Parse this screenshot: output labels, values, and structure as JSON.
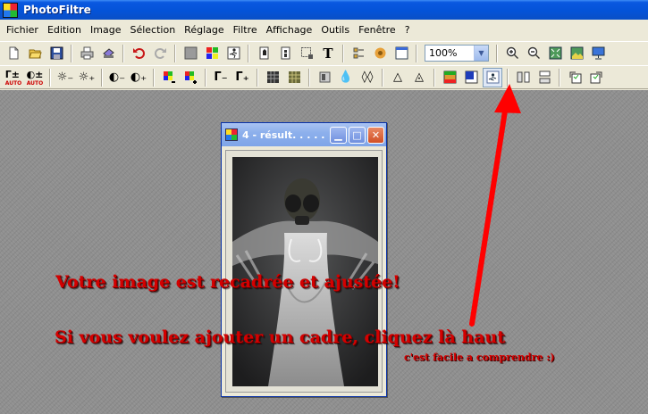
{
  "window": {
    "title": "PhotoFiltre"
  },
  "menu": [
    {
      "label": "Fichier",
      "name": "menu-fichier"
    },
    {
      "label": "Edition",
      "name": "menu-edition"
    },
    {
      "label": "Image",
      "name": "menu-image"
    },
    {
      "label": "Sélection",
      "name": "menu-selection"
    },
    {
      "label": "Réglage",
      "name": "menu-reglage"
    },
    {
      "label": "Filtre",
      "name": "menu-filtre"
    },
    {
      "label": "Affichage",
      "name": "menu-affichage"
    },
    {
      "label": "Outils",
      "name": "menu-outils"
    },
    {
      "label": "Fenêtre",
      "name": "menu-fenetre"
    },
    {
      "label": "?",
      "name": "menu-help"
    }
  ],
  "toolbar1": {
    "zoom_value": "100%",
    "icons": [
      "new-file-icon",
      "open-folder-icon",
      "save-disk-icon",
      "print-icon",
      "scan-icon",
      "undo-icon",
      "redo-icon",
      "gray-square-icon",
      "color-grid-icon",
      "run-macro-icon",
      "copy-image-icon",
      "paste-image-icon",
      "selection-icon",
      "text-tool-icon",
      "layers-icon",
      "gear-flower-icon",
      "window-icon",
      "zoom-in-icon",
      "zoom-out-icon",
      "fit-window-icon",
      "full-image-icon",
      "slideshow-icon"
    ]
  },
  "toolbar2": {
    "auto_label": "AUTO",
    "icons": [
      "auto-levels-icon",
      "auto-contrast-icon",
      "brightness-minus-icon",
      "brightness-plus-icon",
      "contrast-minus-icon",
      "contrast-plus-icon",
      "saturation-minus-icon",
      "saturation-plus-icon",
      "gamma-minus-icon",
      "gamma-plus-icon",
      "dither-icon",
      "noise-icon",
      "blur-icon",
      "drop-icon",
      "drop-double-icon",
      "sharpen-icon",
      "sharpen-double-icon",
      "gradient-color-icon",
      "gradient-bw-icon",
      "frame-decor-icon",
      "flip-horizontal-icon",
      "flip-vertical-icon",
      "rotate-left-icon",
      "rotate-right-icon"
    ]
  },
  "image_window": {
    "title": "4 - résult. . . . ."
  },
  "overlay": {
    "line1": "Votre image est recadrée et ajustée!",
    "line2": "Si vous voulez ajouter un cadre, cliquez là haut",
    "note": "c'est facile a comprendre :)"
  },
  "colors": {
    "titlebar": "#0453d8",
    "workspace": "#8f8f8f",
    "annotation_red": "#ff0000",
    "overlay_text": "#d40000"
  }
}
